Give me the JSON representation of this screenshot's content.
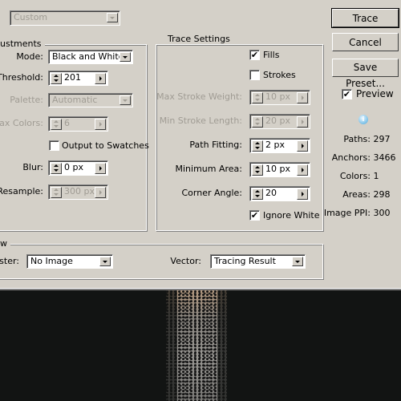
{
  "preset": {
    "value": "Custom"
  },
  "adjustments": {
    "title": "ustments",
    "mode": {
      "label": "Mode:",
      "value": "Black and White"
    },
    "threshold": {
      "label": "Threshold:",
      "value": "201"
    },
    "palette": {
      "label": "Palette:",
      "value": "Automatic"
    },
    "max_colors": {
      "label": "Max Colors:",
      "value": "6"
    },
    "output_swatches": {
      "label": "Output to Swatches",
      "checked": false
    },
    "blur": {
      "label": "Blur:",
      "value": "0 px"
    },
    "resample": {
      "label": "Resample:",
      "value": "300 px"
    }
  },
  "trace_settings": {
    "title": "Trace Settings",
    "fills": {
      "label": "Fills",
      "checked": true
    },
    "strokes": {
      "label": "Strokes",
      "checked": false
    },
    "max_stroke_weight": {
      "label": "Max Stroke Weight:",
      "value": "10 px"
    },
    "min_stroke_length": {
      "label": "Min Stroke Length:",
      "value": "20 px"
    },
    "path_fitting": {
      "label": "Path Fitting:",
      "value": "2 px"
    },
    "minimum_area": {
      "label": "Minimum Area:",
      "value": "10 px"
    },
    "corner_angle": {
      "label": "Corner Angle:",
      "value": "20"
    },
    "ignore_white": {
      "label": "Ignore White",
      "checked": true
    }
  },
  "view": {
    "title": "w",
    "raster": {
      "label": "aster:",
      "value": "No Image"
    },
    "vector": {
      "label": "Vector:",
      "value": "Tracing Result"
    }
  },
  "buttons": {
    "trace": "Trace",
    "cancel": "Cancel",
    "save_preset": "Save Preset..."
  },
  "preview": {
    "label": "Preview",
    "checked": true
  },
  "stats": [
    {
      "k": "Paths:",
      "v": "297"
    },
    {
      "k": "Anchors:",
      "v": "3466"
    },
    {
      "k": "Colors:",
      "v": "1"
    },
    {
      "k": "Areas:",
      "v": "298"
    },
    {
      "k": "Image PPI:",
      "v": "300"
    }
  ],
  "check": "✔"
}
